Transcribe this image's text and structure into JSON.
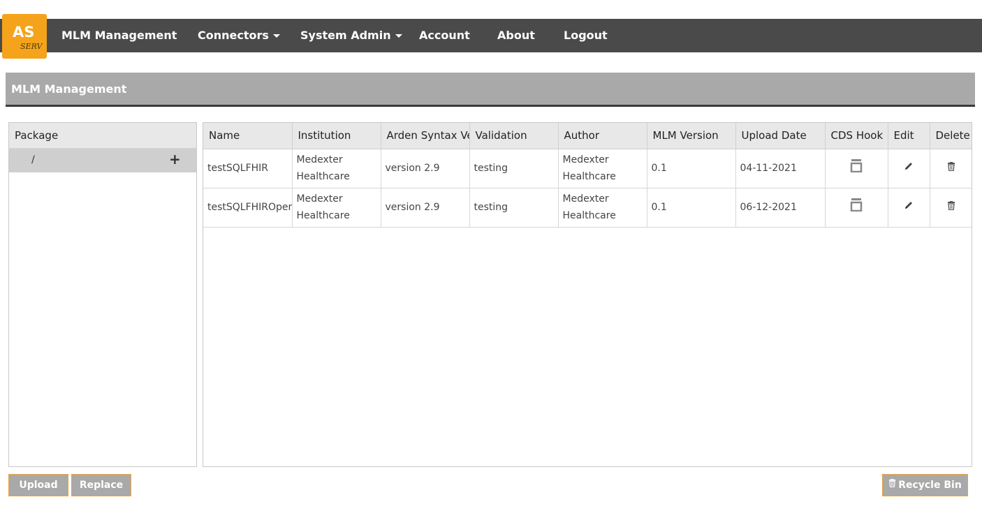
{
  "logo": {
    "main": "AS",
    "sub": "SERV"
  },
  "nav": {
    "items": [
      {
        "label": "MLM Management"
      },
      {
        "label": "Connectors"
      },
      {
        "label": "System Admin"
      },
      {
        "label": "Account"
      },
      {
        "label": "About"
      },
      {
        "label": "Logout"
      }
    ]
  },
  "panel": {
    "title": "MLM Management"
  },
  "package": {
    "header": "Package",
    "root": "/"
  },
  "table": {
    "columns": [
      "Name",
      "Institution",
      "Arden Syntax Version",
      "Validation",
      "Author",
      "MLM Version",
      "Upload Date",
      "CDS Hook",
      "Edit",
      "Delete"
    ],
    "rows": [
      {
        "name": "testSQLFHIR",
        "institution": "Medexter Healthcare",
        "arden": "version 2.9",
        "validation": "testing",
        "author": "Medexter Healthcare",
        "mlm_version": "0.1",
        "upload_date": "04-11-2021"
      },
      {
        "name": "testSQLFHIROpenEHR",
        "institution": "Medexter Healthcare",
        "arden": "version 2.9",
        "validation": "testing",
        "author": "Medexter Healthcare",
        "mlm_version": "0.1",
        "upload_date": "06-12-2021"
      }
    ]
  },
  "buttons": {
    "upload": "Upload",
    "replace": "Replace",
    "recycle_bin": "Recycle Bin"
  },
  "colors": {
    "navbar": "#4a4a4a",
    "logo": "#f5a31a",
    "panel_header": "#a9a9a9",
    "button": "#a9a9a9",
    "button_border": "#e8a33b"
  }
}
